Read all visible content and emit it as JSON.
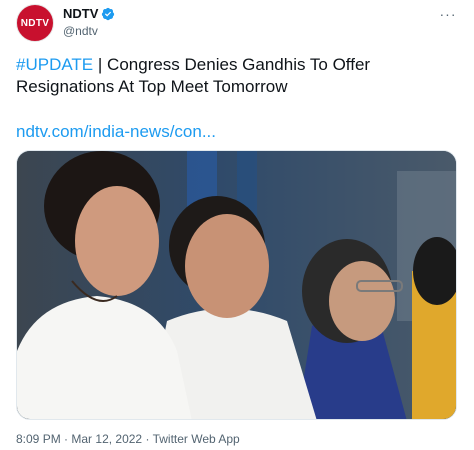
{
  "tweet": {
    "avatar_text": "NDTV",
    "display_name": "NDTV",
    "handle": "@ndtv",
    "more_label": "···",
    "hashtag": "#UPDATE",
    "separator": "|",
    "headline": "Congress Denies Gandhis To Offer Resignations At Top Meet Tomorrow",
    "link_text": "ndtv.com/india-news/con...",
    "time": "8:09 PM",
    "date": "Mar 12, 2022",
    "source": "Twitter Web App",
    "dot": "·"
  },
  "colors": {
    "brand": "#c8102e",
    "link": "#1d9bf0",
    "verified": "#1d9bf0",
    "muted": "#536471"
  },
  "icons": {
    "verified": "verified-badge-icon",
    "more": "more-options-icon"
  }
}
